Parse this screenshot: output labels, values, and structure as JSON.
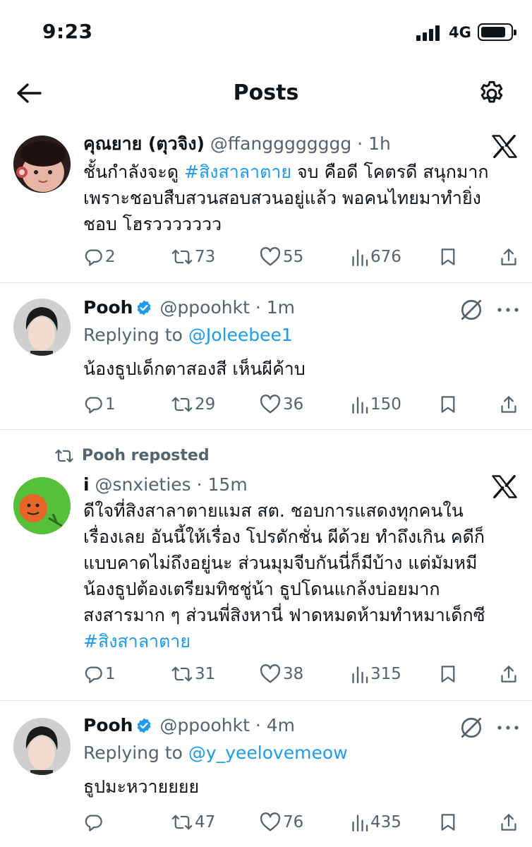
{
  "status_bar": {
    "time": "9:23",
    "network": "4G"
  },
  "header": {
    "title": "Posts"
  },
  "posts": [
    {
      "name": "คุณยาย (ตุวจิง)",
      "handle": "@ffangggggggg",
      "time": "1h",
      "lines": [
        {
          "pre": "ชั้นกำลังจะดู ",
          "tag": "#สิงสาลาตาย",
          "post": " จบ คือดี โคตรดี สนุกมาก"
        },
        {
          "pre": "เพราะชอบสืบสวนสอบสวนอยู่แล้ว พอคนไทยมาทำยิ่ง",
          "tag": "",
          "post": ""
        },
        {
          "pre": "ชอบ โฮรววววววว",
          "tag": "",
          "post": ""
        }
      ],
      "replies": "2",
      "reposts": "73",
      "likes": "55",
      "views": "676"
    },
    {
      "name": "Pooh",
      "handle": "@ppoohkt",
      "time": "1m",
      "replying_label": "Replying to",
      "replying_to": "@Joleebee1",
      "lines": [
        {
          "pre": "น้องธูปเด็กตาสองสี เห็นผีค้าบ",
          "tag": "",
          "post": ""
        }
      ],
      "replies": "1",
      "reposts": "29",
      "likes": "36",
      "views": "150"
    },
    {
      "repost_label": "Pooh reposted",
      "name": "i",
      "handle": "@snxieties",
      "time": "15m",
      "lines": [
        {
          "pre": "ดีใจที่สิงสาลาตายแมส สต. ชอบการแสดงทุกคนใน",
          "tag": "",
          "post": ""
        },
        {
          "pre": "เรื่องเลย อันนี้ให้เรื่อง โปรดักชั่น ผีด้วย ทำถึงเกิน คดีก็",
          "tag": "",
          "post": ""
        },
        {
          "pre": "แบบคาดไม่ถึงอยู่นะ ส่วนมุมจีบกันนี่ก็มีบ้าง แต่มัมหมี",
          "tag": "",
          "post": ""
        },
        {
          "pre": "น้องธูปต้องเตรียมทิชชู่น้า ธูปโดนแกล้งบ่อยมาก",
          "tag": "",
          "post": ""
        },
        {
          "pre": "สงสารมาก ๆ ส่วนพี่สิงหานี่ ฟาดหมดห้ามทำหมาเด็กซี",
          "tag": "",
          "post": ""
        },
        {
          "pre": "",
          "tag": "#สิงสาลาตาย",
          "post": ""
        }
      ],
      "replies": "1",
      "reposts": "31",
      "likes": "38",
      "views": "315"
    },
    {
      "name": "Pooh",
      "handle": "@ppoohkt",
      "time": "4m",
      "replying_label": "Replying to",
      "replying_to": "@y_yeelovemeow",
      "lines": [
        {
          "pre": "ธูปมะหวายยยย",
          "tag": "",
          "post": ""
        }
      ],
      "replies": "",
      "reposts": "47",
      "likes": "76",
      "views": "435"
    }
  ],
  "colors": {
    "accent": "#1d9bf0",
    "text": "#0f1419",
    "muted": "#536471",
    "divider": "#e6e9ec"
  },
  "icons": [
    "back-arrow-icon",
    "gear-icon",
    "verified-badge-icon",
    "x-logo-icon",
    "grok-icon",
    "more-icon",
    "reply-icon",
    "repost-icon",
    "like-icon",
    "views-icon",
    "bookmark-icon",
    "share-icon"
  ]
}
